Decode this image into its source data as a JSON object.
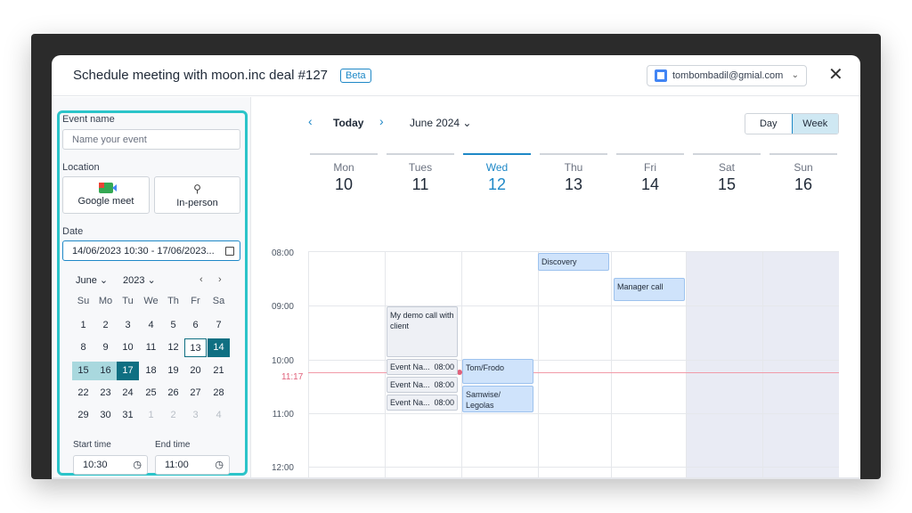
{
  "header": {
    "title": "Schedule meeting with moon.inc deal #127",
    "badge": "Beta",
    "account_email": "tombombadil@gmial.com"
  },
  "form": {
    "event_name_label": "Event name",
    "event_name_placeholder": "Name your event",
    "location_label": "Location",
    "location_options": [
      "Google meet",
      "In-person"
    ],
    "date_label": "Date",
    "date_value": "14/06/2023 10:30 - 17/06/2023...",
    "mini_calendar": {
      "month": "June",
      "year": "2023",
      "weekdays": [
        "Su",
        "Mo",
        "Tu",
        "We",
        "Th",
        "Fr",
        "Sa"
      ],
      "weeks": [
        [
          "1",
          "2",
          "3",
          "4",
          "5",
          "6",
          "7"
        ],
        [
          "8",
          "9",
          "10",
          "11",
          "12",
          "13",
          "14"
        ],
        [
          "15",
          "16",
          "17",
          "18",
          "19",
          "20",
          "21"
        ],
        [
          "22",
          "23",
          "24",
          "25",
          "26",
          "27",
          "28"
        ],
        [
          "29",
          "30",
          "31",
          "1",
          "2",
          "3",
          "4"
        ]
      ]
    },
    "start_time_label": "Start time",
    "start_time_value": "10:30",
    "end_time_label": "End time",
    "end_time_value": "11:00"
  },
  "calendar": {
    "today_label": "Today",
    "month_label": "June 2024",
    "view_options": [
      "Day",
      "Week"
    ],
    "active_view": "Week",
    "days": [
      {
        "name": "Mon",
        "date": "10"
      },
      {
        "name": "Tues",
        "date": "11"
      },
      {
        "name": "Wed",
        "date": "12"
      },
      {
        "name": "Thu",
        "date": "13"
      },
      {
        "name": "Fri",
        "date": "14"
      },
      {
        "name": "Sat",
        "date": "15"
      },
      {
        "name": "Sun",
        "date": "16"
      }
    ],
    "hours": [
      "08:00",
      "09:00",
      "10:00",
      "11:00",
      "12:00"
    ],
    "current_time": "11:17",
    "events": {
      "discovery": "Discovery",
      "manager_call": "Manager call",
      "demo_call": "My demo call with client",
      "event_1_name": "Event Na...",
      "event_1_time": "08:00",
      "event_2_name": "Event Na...",
      "event_2_time": "08:00",
      "event_3_name": "Event Na...",
      "event_3_time": "08:00",
      "tom_frodo": "Tom/Frodo",
      "samwise_legolas": "Samwise/ Legolas"
    }
  },
  "colors": {
    "accent": "#1e88c7",
    "highlight_border": "#2bc4c9",
    "selected_day": "#0f6f82",
    "range_day": "#a9d8de",
    "event_fill": "#cfe3fb",
    "now_line": "#e0607a"
  }
}
